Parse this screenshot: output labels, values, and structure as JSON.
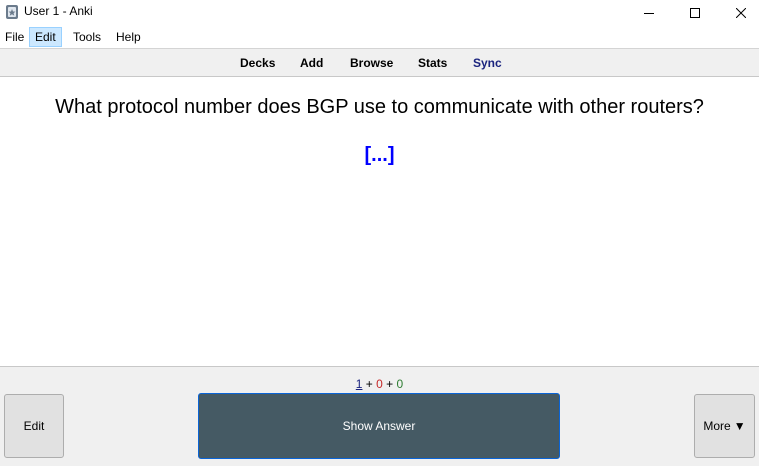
{
  "window": {
    "title": "User 1 - Anki",
    "icon": "anki-app-icon"
  },
  "menu": {
    "items": [
      {
        "label": "File"
      },
      {
        "label": "Edit",
        "active": true
      },
      {
        "label": "Tools"
      },
      {
        "label": "Help"
      }
    ]
  },
  "toolbar": {
    "decks": "Decks",
    "add": "Add",
    "browse": "Browse",
    "stats": "Stats",
    "sync": "Sync"
  },
  "card": {
    "question": "What protocol number does BGP use to communicate with other routers?",
    "cloze": "[...]"
  },
  "counts": {
    "new": "1",
    "plus1": " + ",
    "learning": "0",
    "plus2": " + ",
    "review": "0"
  },
  "buttons": {
    "edit": "Edit",
    "show_answer": "Show Answer",
    "more": "More",
    "more_arrow": "▼"
  },
  "colors": {
    "show_answer_bg": "#455a64",
    "cloze": "#0000ff",
    "sync": "#1a237e",
    "new_count": "#1a237e",
    "learning_count": "#c62828",
    "review_count": "#2e7d32"
  }
}
